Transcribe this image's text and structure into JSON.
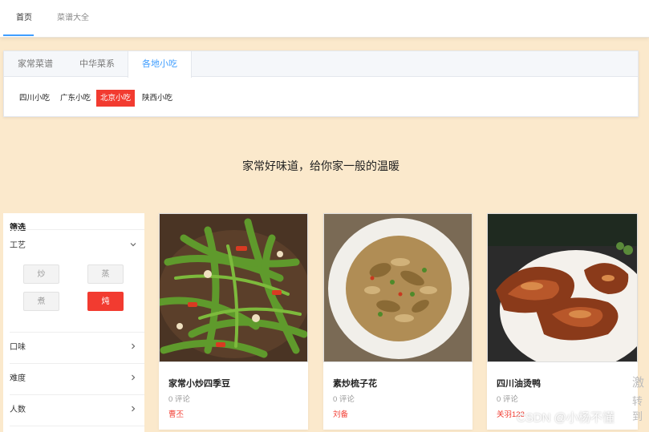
{
  "nav": {
    "tabs": [
      "首页",
      "菜谱大全"
    ]
  },
  "category": {
    "tabs": [
      "家常菜谱",
      "中华菜系",
      "各地小吃"
    ],
    "subs": [
      "四川小吃",
      "广东小吃",
      "北京小吃",
      "陕西小吃"
    ]
  },
  "slogan": "家常好味道，给你家一般的温暖",
  "filter": {
    "title": "筛选",
    "craft": {
      "label": "工艺",
      "options": [
        "炒",
        "蒸",
        "煮",
        "炖"
      ]
    },
    "flavor": "口味",
    "difficulty": "难度",
    "people": "人数"
  },
  "recipes": [
    {
      "name": "家常小炒四季豆",
      "comments": "0 评论",
      "author": "曹丕"
    },
    {
      "name": "素炒梳子花",
      "comments": "0 评论",
      "author": "刘备"
    },
    {
      "name": "四川油烫鸭",
      "comments": "0 评论",
      "author": "关羽123"
    }
  ],
  "watermark": "CSDN @小杨不懂",
  "side_hint": [
    "激",
    "转到"
  ],
  "colors": {
    "accent": "#409eff",
    "active": "#f23b30",
    "background": "#fbe9cc"
  }
}
